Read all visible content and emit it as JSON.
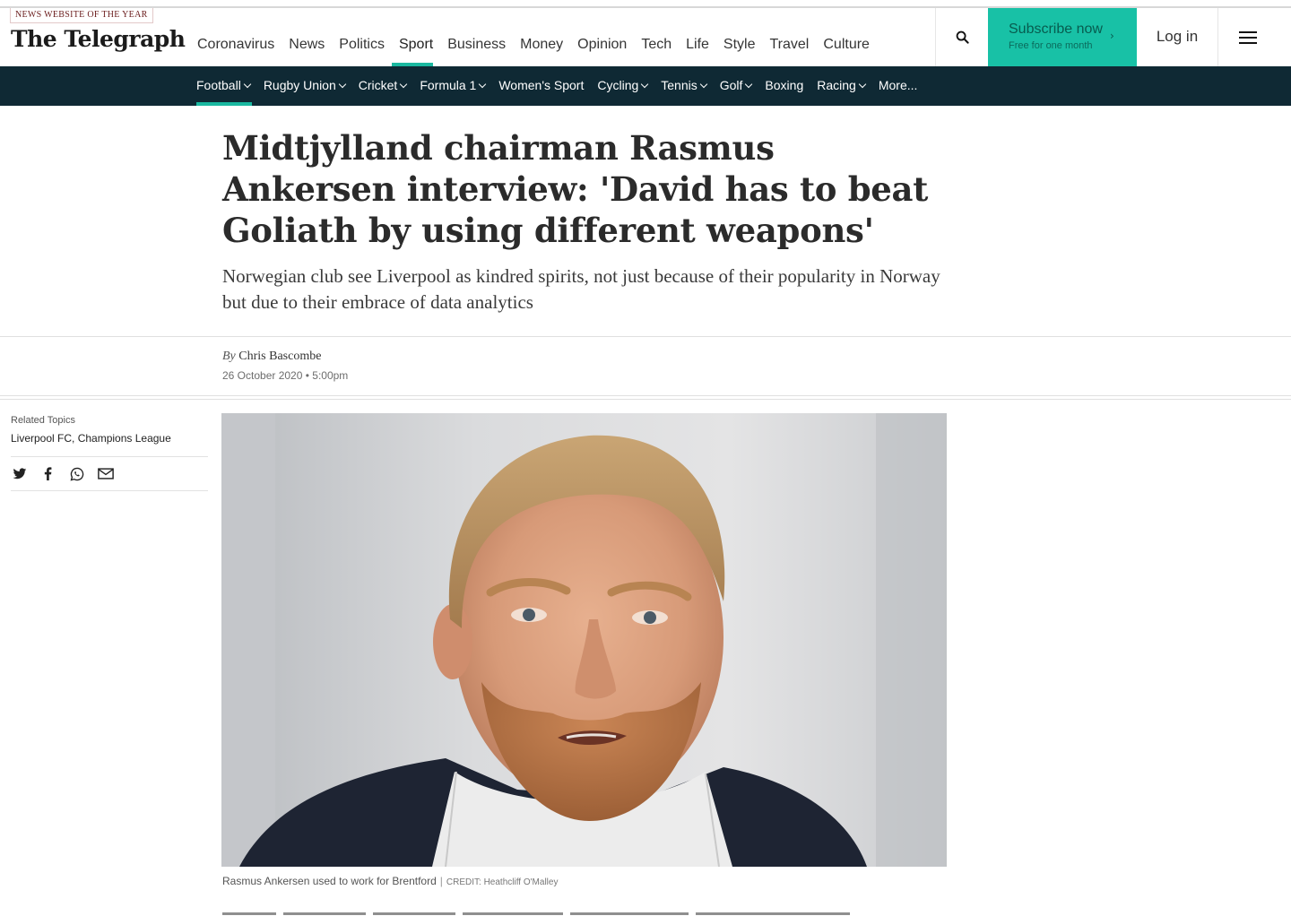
{
  "header": {
    "award": "NEWS WEBSITE OF THE YEAR",
    "logo": "The Telegraph",
    "primary_nav": [
      "Coronavirus",
      "News",
      "Politics",
      "Sport",
      "Business",
      "Money",
      "Opinion",
      "Tech",
      "Life",
      "Style",
      "Travel",
      "Culture"
    ],
    "active_primary": "Sport",
    "search_icon": "search-icon",
    "subscribe_title": "Subscribe now",
    "subscribe_sub": "Free for one month",
    "login": "Log in",
    "menu_icon": "hamburger-menu-icon"
  },
  "subnav": {
    "items": [
      {
        "label": "Football",
        "caret": true,
        "active": true
      },
      {
        "label": "Rugby Union",
        "caret": true
      },
      {
        "label": "Cricket",
        "caret": true
      },
      {
        "label": "Formula 1",
        "caret": true
      },
      {
        "label": "Women's Sport",
        "caret": false
      },
      {
        "label": "Cycling",
        "caret": true
      },
      {
        "label": "Tennis",
        "caret": true
      },
      {
        "label": "Golf",
        "caret": true
      },
      {
        "label": "Boxing",
        "caret": false
      },
      {
        "label": "Racing",
        "caret": true
      },
      {
        "label": "More...",
        "caret": false
      }
    ]
  },
  "article": {
    "headline": "Midtjylland chairman Rasmus Ankersen interview: 'David has to beat Goliath by using different weapons'",
    "standfirst": "Norwegian club see Liverpool as kindred spirits, not just because of their popularity in Norway but due to their embrace of data analytics",
    "by_prefix": "By",
    "author": "Chris Bascombe",
    "date": "26 October 2020 • 5:00pm",
    "caption": "Rasmus Ankersen used to work for Brentford",
    "credit": "CREDIT: Heathcliff O'Malley"
  },
  "sidebar": {
    "related_label": "Related Topics",
    "related_topics": "Liverpool FC, Champions League",
    "share_icons": [
      "twitter-icon",
      "facebook-icon",
      "whatsapp-icon",
      "email-icon"
    ]
  },
  "colors": {
    "accent": "#18c1a6",
    "subnav_bg": "#0f2934"
  }
}
